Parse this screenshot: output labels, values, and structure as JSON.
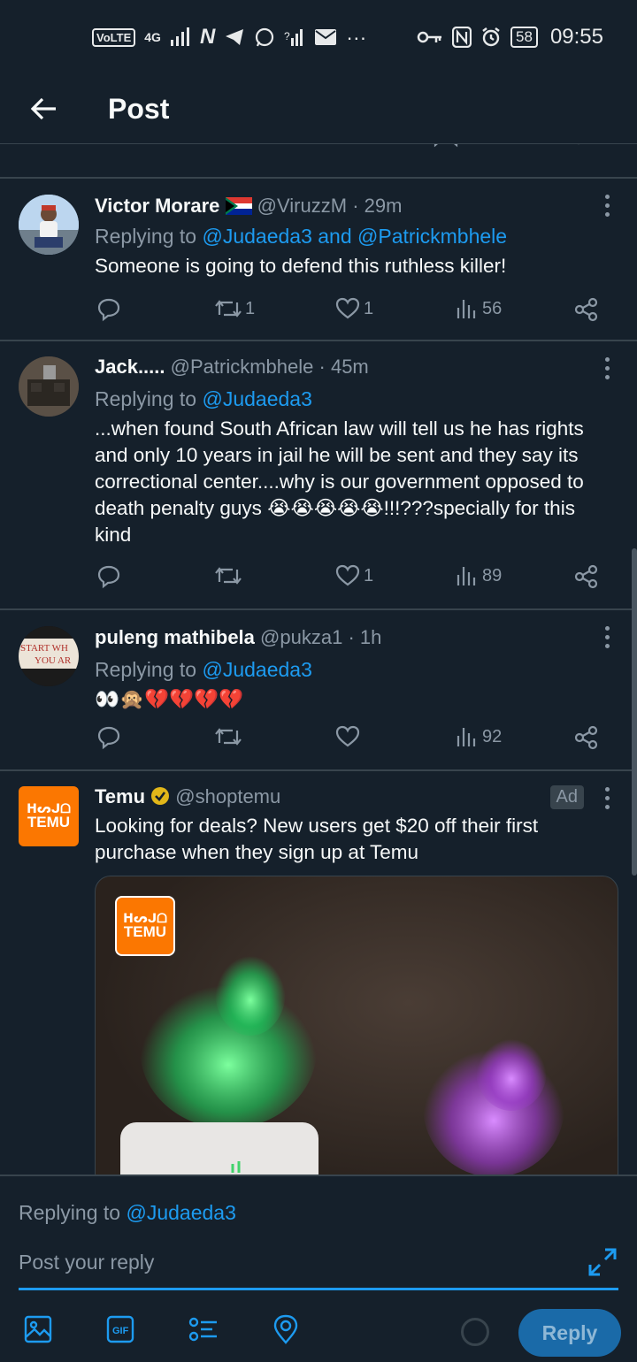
{
  "status_bar": {
    "network": "VoLTE",
    "signal": "4G",
    "time": "09:55",
    "battery": "58",
    "overflow": "···"
  },
  "header": {
    "title": "Post"
  },
  "posts": [
    {
      "display_name": "Victor Morare",
      "handle": "@ViruzzM",
      "time_ago": "29m",
      "replying_prefix": "Replying to",
      "replying_to": "@Judaeda3 and @Patrickmbhele",
      "text": "Someone is going to defend this ruthless killer!",
      "retweets": "1",
      "likes": "1",
      "views": "56"
    },
    {
      "display_name": "Jack.....",
      "handle": "@Patrickmbhele",
      "time_ago": "45m",
      "replying_prefix": "Replying to",
      "replying_to": "@Judaeda3",
      "text": "...when found South African law will tell us he has rights and only 10 years in jail he will be sent and they say its correctional center....why is our government opposed to death penalty guys 😭😭😭😭😭!!!???specially for this kind",
      "retweets": "",
      "likes": "1",
      "views": "89"
    },
    {
      "display_name": "puleng mathibela",
      "handle": "@pukza1",
      "time_ago": "1h",
      "replying_prefix": "Replying to",
      "replying_to": "@Judaeda3",
      "text": "👀🙊💔💔💔💔",
      "retweets": "",
      "likes": "",
      "views": "92",
      "avatar_text_1": "START WH",
      "avatar_text_2": "YOU AR"
    }
  ],
  "ad": {
    "display_name": "Temu",
    "handle": "@shoptemu",
    "badge": "Ad",
    "text": "Looking for deals? New users get $20 off their first purchase when they sign up at Temu",
    "logo_text": "TEMU",
    "logo_glyphs": "ᕼᔕᒍᗝ"
  },
  "reply_panel": {
    "replying_prefix": "Replying to",
    "replying_to": "@Judaeda3",
    "placeholder": "Post your reply",
    "button_label": "Reply"
  },
  "colors": {
    "background": "#15202b",
    "accent": "#1d9bf0",
    "temu_orange": "#fb7701",
    "verified_gold": "#e2b719"
  }
}
